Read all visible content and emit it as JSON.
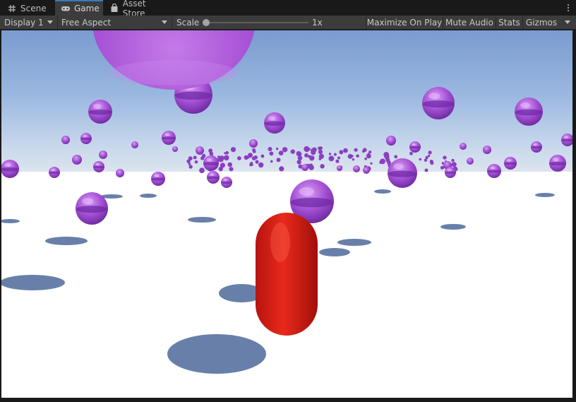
{
  "tabs": [
    {
      "label": "Scene",
      "icon": "grid-icon",
      "active": false
    },
    {
      "label": "Game",
      "icon": "gamepad-icon",
      "active": true
    },
    {
      "label": "Asset Store",
      "icon": "bag-icon",
      "active": false
    }
  ],
  "toolbar": {
    "display": "Display 1",
    "aspect": "Free Aspect",
    "scale_label": "Scale",
    "scale_value": "1x",
    "maximize": "Maximize On Play",
    "mute": "Mute Audio",
    "stats": "Stats",
    "gizmos": "Gizmos"
  },
  "colors": {
    "accent": "#3a79bb",
    "panel": "#3c3c3c",
    "sphere": "#a64fd6",
    "capsule": "#d11a12",
    "ground": "#ffffff",
    "sky_top": "#7c9ed1"
  }
}
